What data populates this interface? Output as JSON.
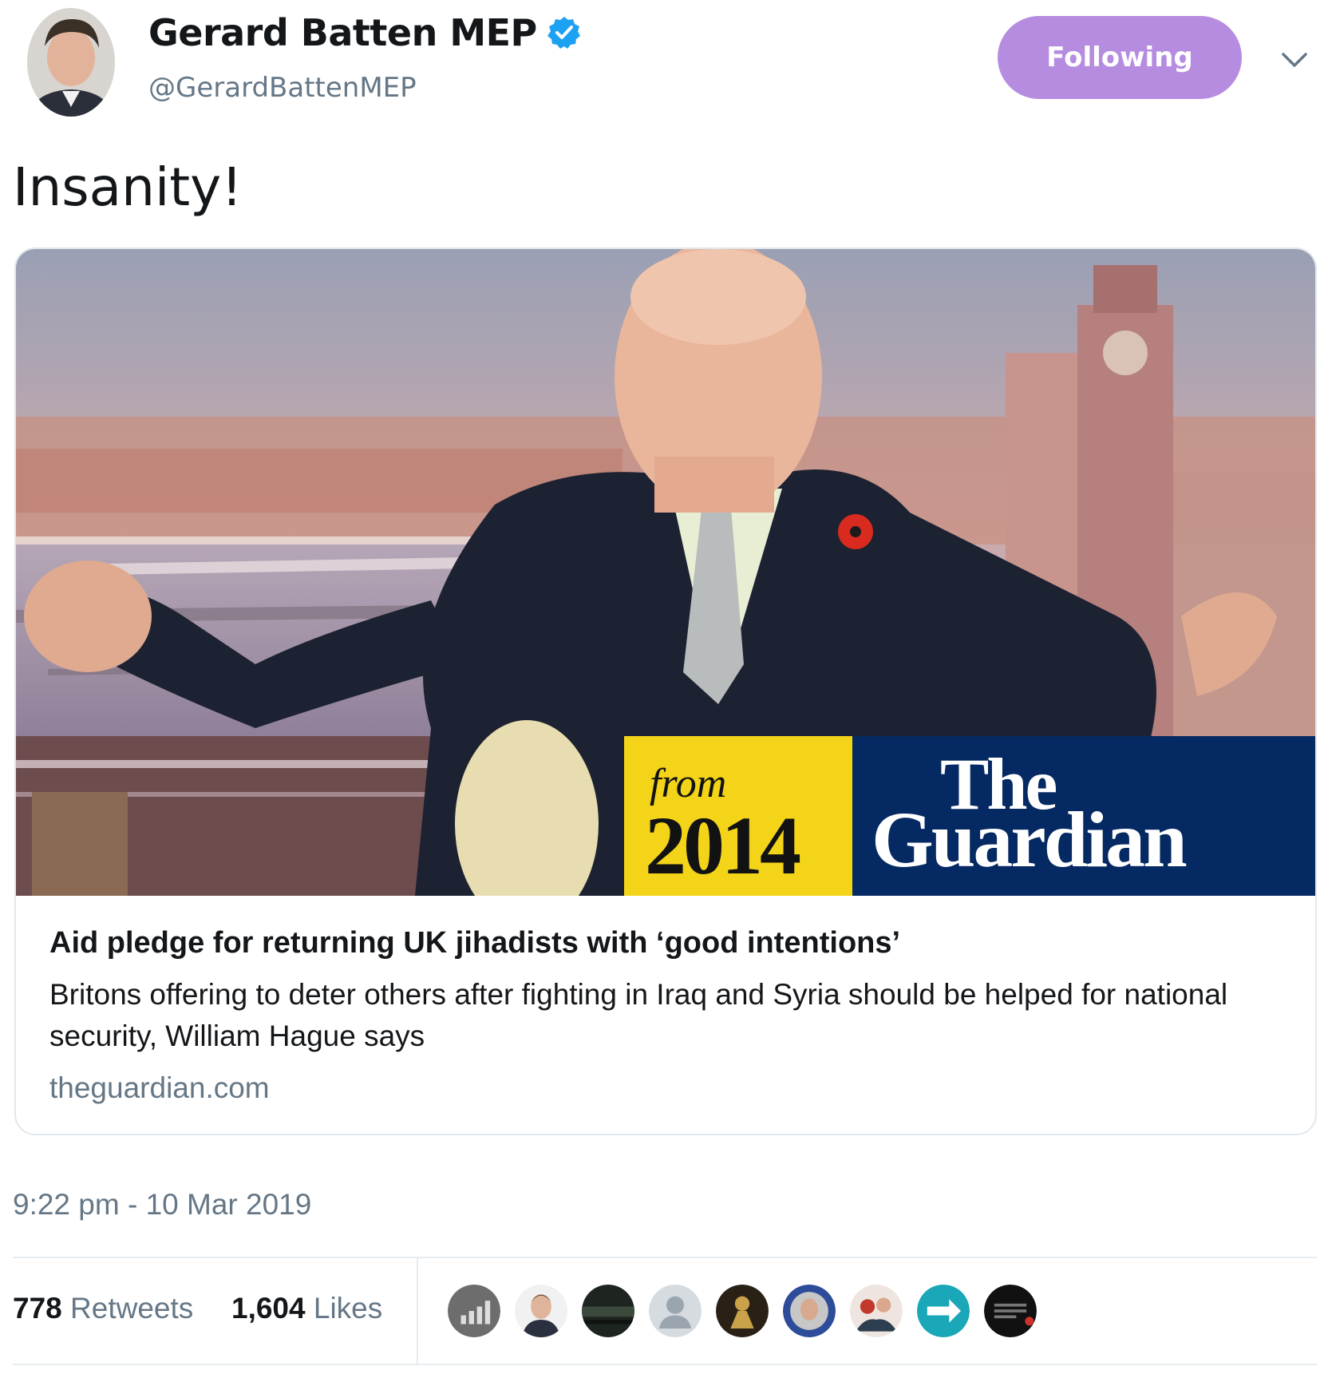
{
  "tweet": {
    "display_name": "Gerard Batten MEP",
    "handle": "@GerardBattenMEP",
    "verified_icon": "verified-badge-icon",
    "follow_button_label": "Following",
    "follow_button_color": "#b68ce0",
    "text": "Insanity!",
    "timestamp": "9:22 pm - 10 Mar 2019"
  },
  "card": {
    "image_stamp": {
      "from_label": "from",
      "year": "2014",
      "brand_line1": "The",
      "brand_line2": "Guardian"
    },
    "title": "Aid pledge for returning UK jihadists with ‘good intentions’",
    "description": "Britons offering to deter others after fighting in Iraq and Syria should be helped for national security, William Hague says",
    "domain": "theguardian.com"
  },
  "stats": {
    "retweets_count": "778",
    "retweets_label": "Retweets",
    "likes_count": "1,604",
    "likes_label": "Likes"
  },
  "likers": [
    {
      "icon": "chart-avatar-icon"
    },
    {
      "icon": "person-avatar-icon"
    },
    {
      "icon": "dark-landscape-avatar-icon"
    },
    {
      "icon": "default-profile-avatar-icon"
    },
    {
      "icon": "gold-figure-avatar-icon"
    },
    {
      "icon": "portrait-avatar-icon"
    },
    {
      "icon": "group-avatar-icon"
    },
    {
      "icon": "arrow-logo-avatar-icon"
    },
    {
      "icon": "dark-text-avatar-icon"
    }
  ]
}
